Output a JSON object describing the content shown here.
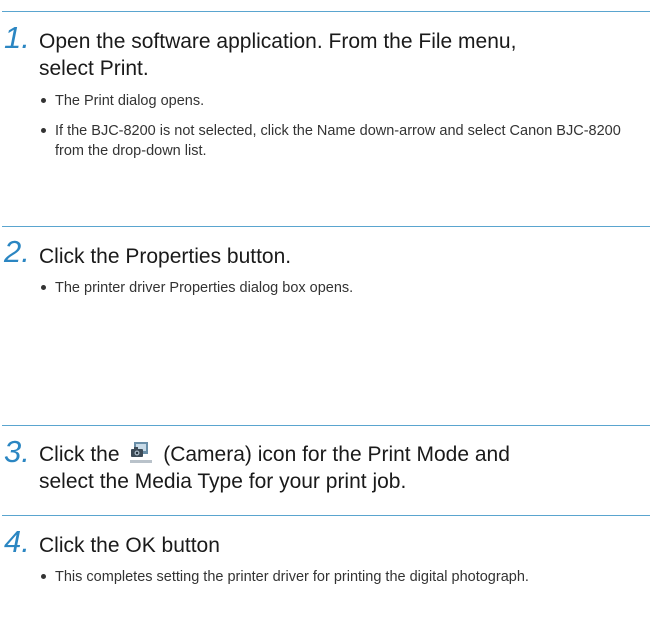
{
  "steps": [
    {
      "number": "1.",
      "title_lines": [
        "Open the software application. From the File menu,",
        "select Print."
      ],
      "bullets": [
        "The Print dialog opens.",
        "If the BJC-8200 is not selected, click the Name down-arrow and select Canon BJC-8200 from the drop-down list."
      ]
    },
    {
      "number": "2.",
      "title_lines": [
        "Click the Properties button."
      ],
      "bullets": [
        "The printer driver Properties dialog box opens."
      ]
    },
    {
      "number": "3.",
      "title_before_icon": "Click the",
      "icon": "camera-icon",
      "title_after_icon": "(Camera) icon for the Print Mode and",
      "title_line2": "select the Media Type for your print job.",
      "bullets": []
    },
    {
      "number": "4.",
      "title_lines": [
        "Click the OK button"
      ],
      "bullets": [
        "This completes setting the printer driver for printing the digital photograph."
      ]
    }
  ],
  "colors": {
    "accent": "#2b86c2",
    "rule": "#5aa5cf",
    "text": "#1a1a1a"
  }
}
